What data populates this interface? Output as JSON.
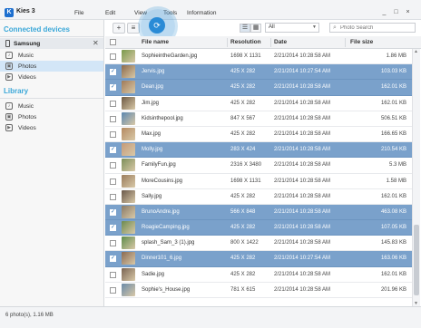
{
  "app": {
    "title": "Kies 3",
    "logo_letter": "K"
  },
  "menu": [
    "File",
    "Edit",
    "View",
    "Tools",
    "Information"
  ],
  "window_controls": {
    "minimize": "_",
    "maximize": "□",
    "close": "×"
  },
  "sidebar": {
    "connected_title": "Connected devices",
    "device": {
      "name": "Samsung",
      "close": "✕"
    },
    "device_items": [
      {
        "label": "Music",
        "icon": "music-icon",
        "active": false
      },
      {
        "label": "Photos",
        "icon": "photos-icon",
        "active": true
      },
      {
        "label": "Videos",
        "icon": "videos-icon",
        "active": false
      }
    ],
    "library_title": "Library",
    "library_items": [
      {
        "label": "Music",
        "icon": "music-icon"
      },
      {
        "label": "Photos",
        "icon": "photos-icon"
      },
      {
        "label": "Videos",
        "icon": "videos-icon"
      }
    ]
  },
  "toolbar": {
    "add_label": "+",
    "filter_value": "All",
    "search_placeholder": "Photo Search"
  },
  "table": {
    "columns": [
      "File name",
      "Resolution",
      "Date",
      "File size"
    ],
    "rows": [
      {
        "name": "SophieintheGarden.jpg",
        "res": "1698 X 1131",
        "date": "2/21/2014 10:28:58 AM",
        "size": "1.86 MB",
        "selected": false,
        "thumb": "#7a9a4c"
      },
      {
        "name": "Jervis.jpg",
        "res": "425 X 282",
        "date": "2/21/2014 10:27:54 AM",
        "size": "103.03 KB",
        "selected": true,
        "thumb": "#8c6a4a"
      },
      {
        "name": "Dean.jpg",
        "res": "425 X 282",
        "date": "2/21/2014 10:28:58 AM",
        "size": "162.01 KB",
        "selected": true,
        "thumb": "#a07a58"
      },
      {
        "name": "Jim.jpg",
        "res": "425 X 282",
        "date": "2/21/2014 10:28:58 AM",
        "size": "162.01 KB",
        "selected": false,
        "thumb": "#6e5a44"
      },
      {
        "name": "Kidsinthepool.jpg",
        "res": "847 X 567",
        "date": "2/21/2014 10:28:58 AM",
        "size": "506.51 KB",
        "selected": false,
        "thumb": "#5a86b0"
      },
      {
        "name": "Max.jpg",
        "res": "425 X 282",
        "date": "2/21/2014 10:28:58 AM",
        "size": "166.65 KB",
        "selected": false,
        "thumb": "#b48a62"
      },
      {
        "name": "Molly.jpg",
        "res": "283 X 424",
        "date": "2/21/2014 10:28:58 AM",
        "size": "210.54 KB",
        "selected": true,
        "thumb": "#c49a78"
      },
      {
        "name": "FamilyFun.jpg",
        "res": "2316 X 3480",
        "date": "2/21/2014 10:28:58 AM",
        "size": "5.3 MB",
        "selected": false,
        "thumb": "#7c8f5a"
      },
      {
        "name": "MoreCousins.jpg",
        "res": "1698 X 1131",
        "date": "2/21/2014 10:28:58 AM",
        "size": "1.58 MB",
        "selected": false,
        "thumb": "#9a7c5c"
      },
      {
        "name": "Sally.jpg",
        "res": "425 X 282",
        "date": "2/21/2014 10:28:58 AM",
        "size": "162.01 KB",
        "selected": false,
        "thumb": "#6a584a"
      },
      {
        "name": "BrunoAndre.jpg",
        "res": "566 X 848",
        "date": "2/21/2014 10:28:58 AM",
        "size": "463.08 KB",
        "selected": true,
        "thumb": "#8a7a66"
      },
      {
        "name": "RoagieCamping.jpg",
        "res": "425 X 282",
        "date": "2/21/2014 10:28:58 AM",
        "size": "107.05 KB",
        "selected": true,
        "thumb": "#6c8a4e"
      },
      {
        "name": "splash_Sam_3 (1).jpg",
        "res": "800 X 1422",
        "date": "2/21/2014 10:28:58 AM",
        "size": "145.83 KB",
        "selected": false,
        "thumb": "#5e8c4a"
      },
      {
        "name": "Dinner101_6.jpg",
        "res": "425 X 282",
        "date": "2/21/2014 10:27:54 AM",
        "size": "163.06 KB",
        "selected": true,
        "thumb": "#8a6a52"
      },
      {
        "name": "Sadie.jpg",
        "res": "425 X 282",
        "date": "2/21/2014 10:28:58 AM",
        "size": "162.01 KB",
        "selected": false,
        "thumb": "#7a6452"
      },
      {
        "name": "Sophie's_House.jpg",
        "res": "781 X 615",
        "date": "2/21/2014 10:28:58 AM",
        "size": "201.96 KB",
        "selected": false,
        "thumb": "#6a8aa8"
      }
    ]
  },
  "status": {
    "text": "6 photo(s), 1.16 MB"
  },
  "colors": {
    "accent": "#3aa7d8",
    "selection": "#7aa1cb",
    "sync_button": "#2a8bd6"
  }
}
